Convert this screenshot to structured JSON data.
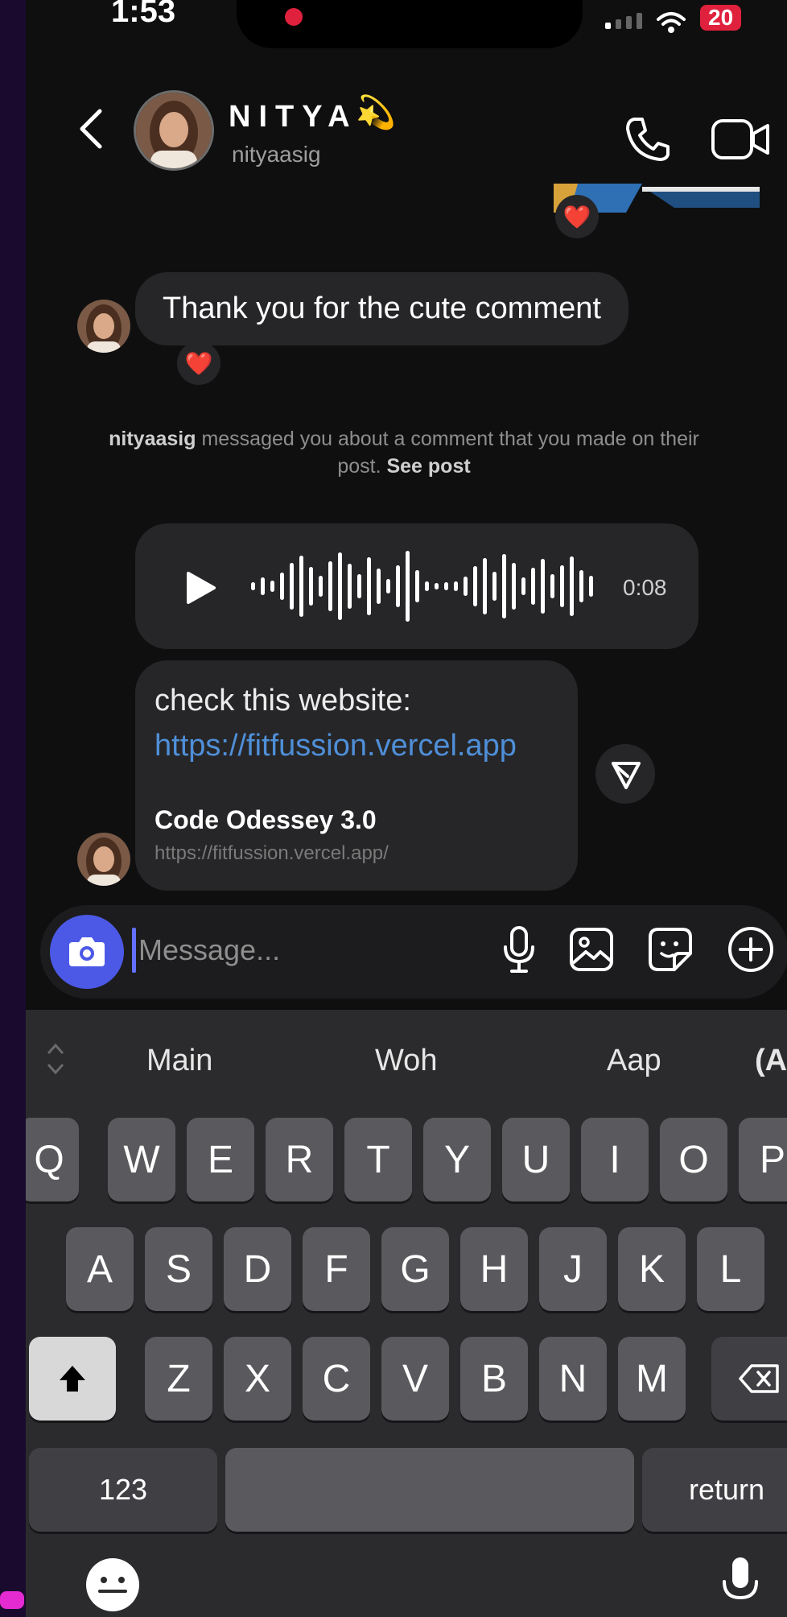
{
  "status_bar": {
    "time": "1:53",
    "battery": "20"
  },
  "header": {
    "name": "NITYA",
    "emoji": "💫",
    "username": "nityaasig"
  },
  "messages": {
    "msg1_text": "Thank you for the cute comment",
    "reaction": "❤️",
    "notice_user": "nityaasig",
    "notice_text": " messaged you about a comment that you made on their post. ",
    "notice_link": "See post",
    "voice_duration": "0:08",
    "link_text": "check this website:",
    "link_url": "https://fitfussion.vercel.app",
    "preview_title": "Code Odessey 3.0",
    "preview_url": "https://fitfussion.vercel.app/"
  },
  "composer": {
    "placeholder": "Message..."
  },
  "keyboard": {
    "suggestions": [
      "Main",
      "Woh",
      "Aap",
      "(A"
    ],
    "row1": [
      "Q",
      "W",
      "E",
      "R",
      "T",
      "Y",
      "U",
      "I",
      "O",
      "P"
    ],
    "row2": [
      "A",
      "S",
      "D",
      "F",
      "G",
      "H",
      "J",
      "K",
      "L"
    ],
    "row3": [
      "Z",
      "X",
      "C",
      "V",
      "B",
      "N",
      "M"
    ],
    "numbers_label": "123",
    "return_label": "return"
  },
  "colors": {
    "accent": "#4c59e6",
    "link": "#4f8fd8",
    "bubble": "#262628",
    "reaction": "#e0213d"
  },
  "icons": [
    "back-icon",
    "phone-icon",
    "video-camera-icon",
    "play-icon",
    "send-icon",
    "camera-icon",
    "mic-icon",
    "gallery-icon",
    "sticker-icon",
    "plus-icon",
    "shift-icon",
    "backspace-icon",
    "emoji-icon",
    "dictation-icon"
  ]
}
